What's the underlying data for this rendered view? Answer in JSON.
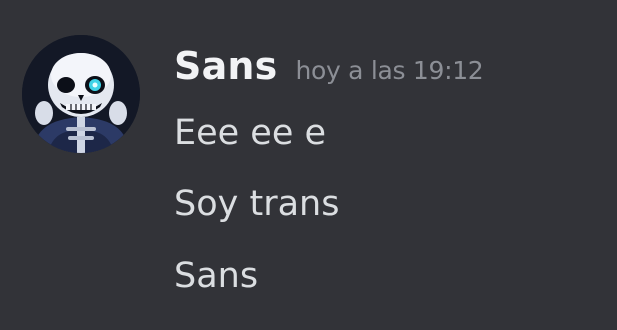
{
  "message": {
    "author": "Sans",
    "timestamp": "hoy a las 19:12",
    "avatar_icon": "skeleton-avatar-icon",
    "lines": [
      "Eee ee e",
      "Soy trans",
      "Sans"
    ]
  },
  "colors": {
    "background": "#323338",
    "username": "#f2f3f5",
    "timestamp": "#8c8f96",
    "message_text": "#dbdee1",
    "eye_glow": "#3fd3e6"
  }
}
